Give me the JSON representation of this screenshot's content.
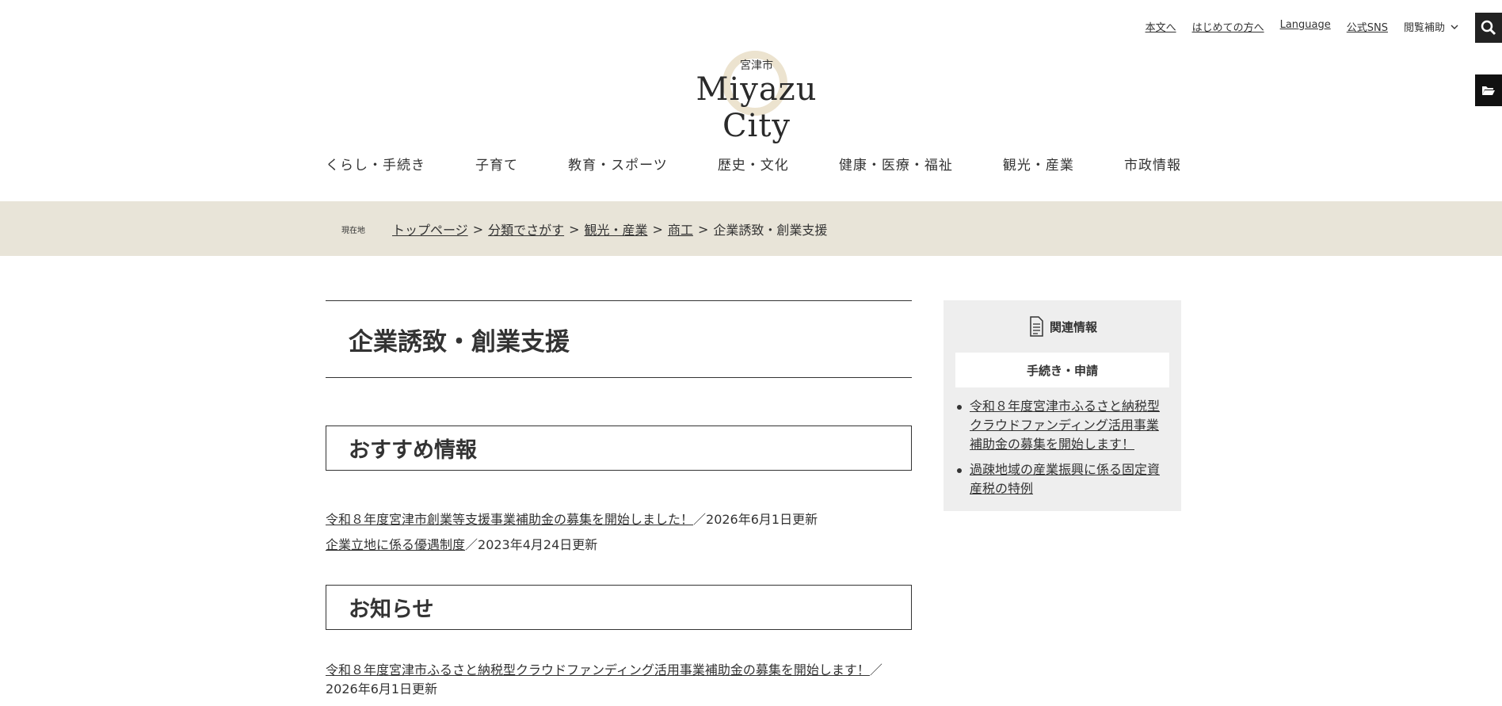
{
  "utility": {
    "links": [
      "本文へ",
      "はじめての方へ",
      "Language",
      "公式SNS"
    ],
    "assist_label": "閲覧補助"
  },
  "logo": {
    "jp": "宮津市",
    "en": "Miyazu City"
  },
  "gnav": [
    "くらし・手続き",
    "子育て",
    "教育・スポーツ",
    "歴史・文化",
    "健康・医療・福祉",
    "観光・産業",
    "市政情報"
  ],
  "breadcrumb": {
    "here_label": "現在地",
    "items": [
      "トップページ",
      "分類でさがす",
      "観光・産業",
      "商工"
    ],
    "current": "企業誘致・創業支援",
    "separator": ">"
  },
  "page_title": "企業誘致・創業支援",
  "recommended": {
    "heading": "おすすめ情報",
    "items": [
      {
        "link": "令和８年度宮津市創業等支援事業補助金の募集を開始しました！",
        "date": "／2026年6月1日更新"
      },
      {
        "link": "企業立地に係る優遇制度",
        "date": "／2023年4月24日更新"
      }
    ]
  },
  "news": {
    "heading": "お知らせ",
    "items": [
      {
        "link": "令和８年度宮津市ふるさと納税型クラウドファンディング活用事業補助金の募集を開始します！",
        "date": "／2026年6月1日更新"
      }
    ]
  },
  "sidebar": {
    "title": "関連情報",
    "subtitle": "手続き・申請",
    "items": [
      "令和８年度宮津市ふるさと納税型クラウドファンディング活用事業補助金の募集を開始します！",
      "過疎地域の産業振興に係る固定資産税の特例"
    ]
  }
}
